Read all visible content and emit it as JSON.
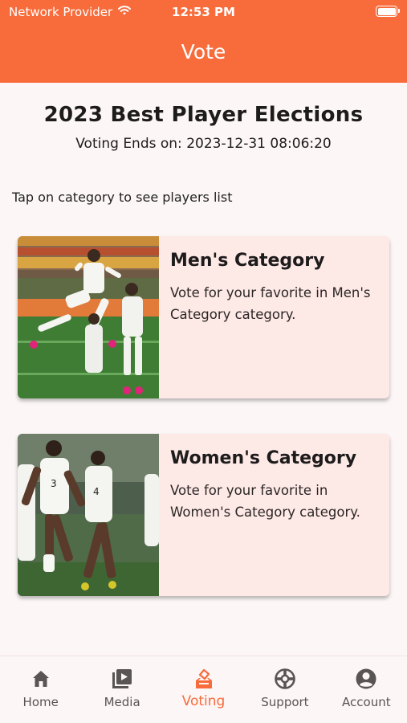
{
  "status_bar": {
    "carrier": "Network Provider",
    "time": "12:53 PM"
  },
  "header": {
    "title": "Vote"
  },
  "election": {
    "title": "2023 Best Player Elections",
    "voting_ends": "Voting Ends on: 2023-12-31 08:06:20"
  },
  "hint": "Tap on category to see players list",
  "categories": [
    {
      "title": "Men's Category",
      "description": "Vote for your favorite in Men's Category category."
    },
    {
      "title": "Women's Category",
      "description": "Vote for your favorite in Women's Category category."
    }
  ],
  "bottom_nav": {
    "items": [
      {
        "label": "Home",
        "icon": "home-icon"
      },
      {
        "label": "Media",
        "icon": "media-icon"
      },
      {
        "label": "Voting",
        "icon": "voting-icon",
        "active": true
      },
      {
        "label": "Support",
        "icon": "support-icon"
      },
      {
        "label": "Account",
        "icon": "account-icon"
      }
    ]
  },
  "colors": {
    "accent": "#f86b3b",
    "background": "#fcf6f6",
    "card": "#fde9e6"
  }
}
